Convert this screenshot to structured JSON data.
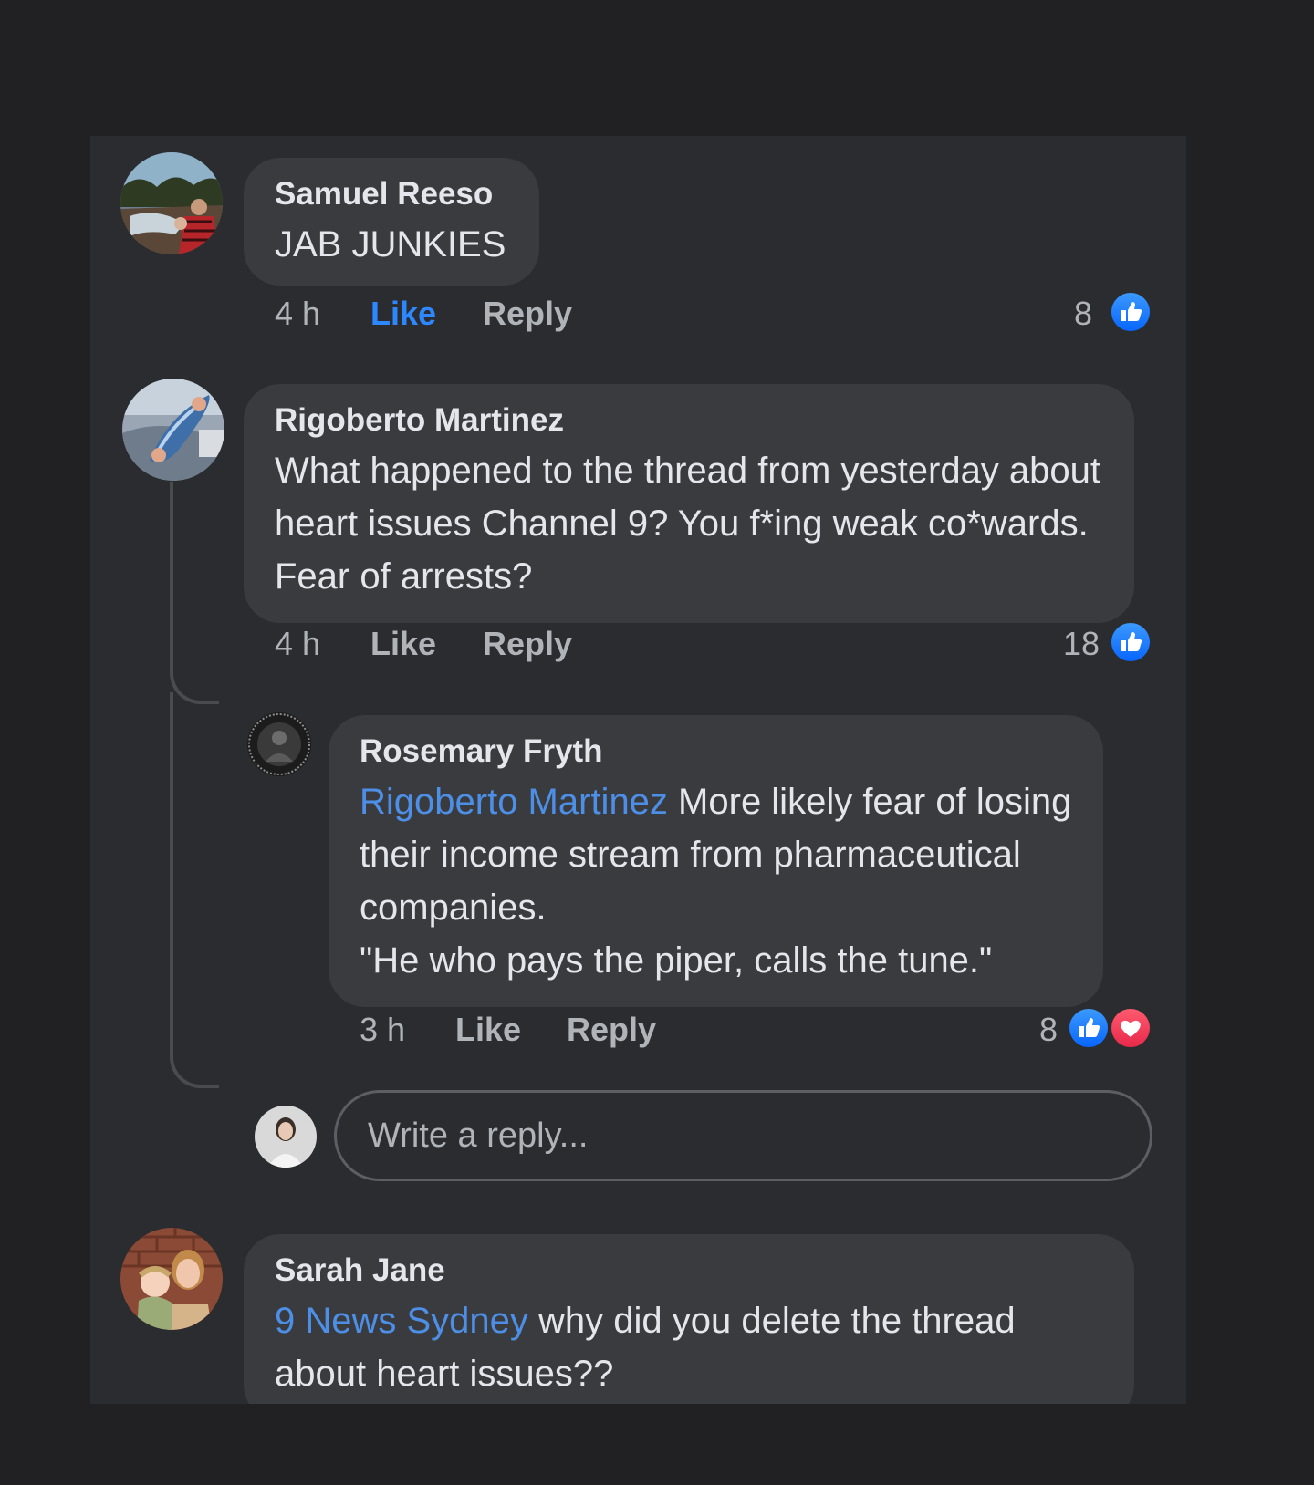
{
  "comments": [
    {
      "author": "Samuel Reeso",
      "text": "JAB JUNKIES",
      "time": "4 h",
      "like_label": "Like",
      "reply_label": "Reply",
      "reaction_count": "8",
      "reactions": [
        "like-icon"
      ],
      "liked": true
    },
    {
      "author": "Rigoberto Martinez",
      "text": "What happened to the thread from yesterday about heart issues Channel 9? You f*ing weak co*wards. Fear of arrests?",
      "time": "4 h",
      "like_label": "Like",
      "reply_label": "Reply",
      "reaction_count": "18",
      "reactions": [
        "like-icon"
      ],
      "replies": [
        {
          "author": "Rosemary Fryth",
          "mention": "Rigoberto Martinez",
          "text_line1": " More likely fear of losing their income stream from pharmaceutical companies.",
          "text_line2": "\"He who pays the piper, calls the tune.\"",
          "time": "3 h",
          "like_label": "Like",
          "reply_label": "Reply",
          "reaction_count": "8",
          "reactions": [
            "like-icon",
            "love-icon"
          ]
        }
      ],
      "reply_placeholder": "Write a reply..."
    },
    {
      "author": "Sarah Jane",
      "mention": "9 News Sydney",
      "text": " why did you delete the thread about heart issues??"
    }
  ],
  "colors": {
    "page_background": "#212124",
    "panel_background": "#2b2c2f",
    "bubble": "#3a3b3e",
    "text_primary": "#e4e6eb",
    "text_secondary": "#b0b3b8",
    "mention": "#4d8fe6",
    "like_active": "#2d88ff",
    "like_reaction": "#0866ff",
    "love_reaction": "#e8294a"
  }
}
